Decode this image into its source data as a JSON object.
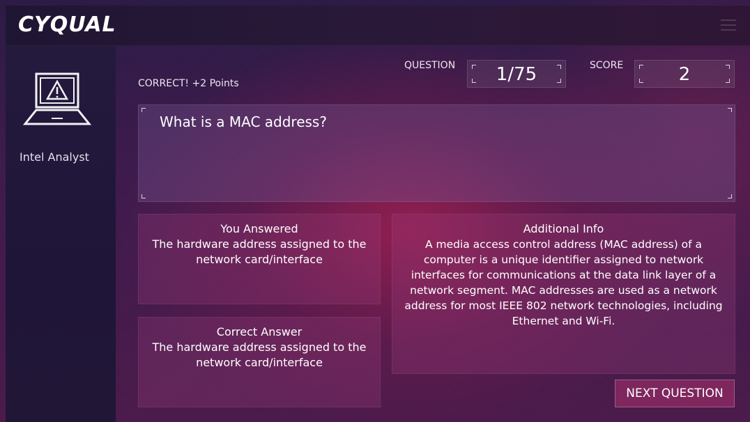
{
  "header": {
    "logo_text": "CYQUAL",
    "menu_icon": "hamburger-icon"
  },
  "sidebar": {
    "icon": "laptop-warning-icon",
    "role": "Intel Analyst"
  },
  "status": {
    "feedback": "CORRECT! +2 Points",
    "question_label": "QUESTION",
    "question_value": "1/75",
    "score_label": "SCORE",
    "score_value": "2"
  },
  "question": {
    "text": "What is a MAC address?"
  },
  "answers": {
    "you_answered_title": "You Answered",
    "you_answered_text": "The hardware address assigned to the network card/interface",
    "correct_title": "Correct Answer",
    "correct_text": "The hardware address assigned to the network card/interface"
  },
  "info": {
    "title": "Additional Info",
    "text": "A media access control address (MAC address) of a computer is a unique identifier assigned to network interfaces for communications at the data link layer of a network segment. MAC addresses are used as a network address for most IEEE 802 network technologies, including Ethernet and Wi-Fi."
  },
  "actions": {
    "next_label": "NEXT QUESTION"
  },
  "colors": {
    "accent": "#a8326e",
    "header_bg": "#1f1633",
    "sidebar_bg": "#241a3e"
  }
}
